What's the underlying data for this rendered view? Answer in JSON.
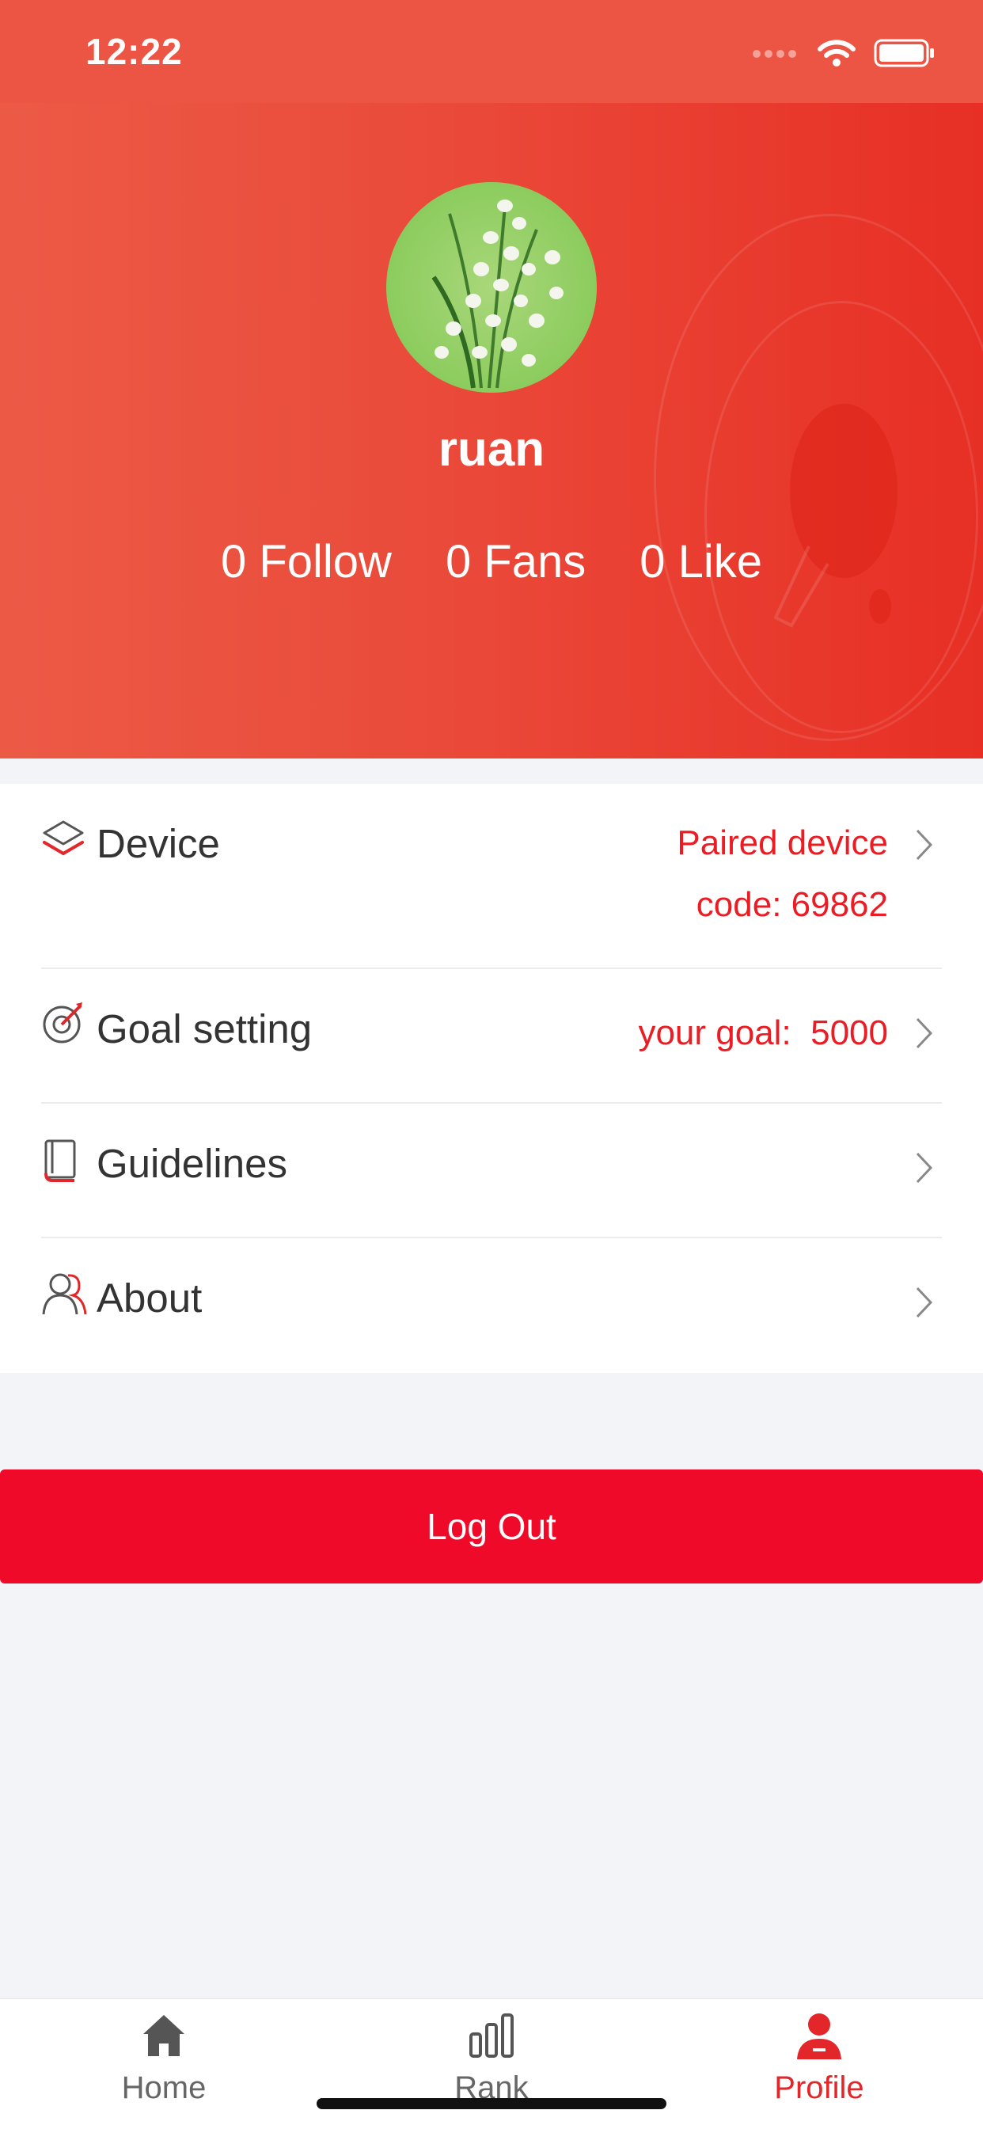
{
  "status_bar": {
    "time": "12:22"
  },
  "profile": {
    "username": "ruan",
    "stats": [
      "0 Follow",
      "0 Fans",
      "0 Like"
    ]
  },
  "menu": {
    "device": {
      "label": "Device",
      "value_line1": "Paired device",
      "value_line2": "code: 69862",
      "icon": "layers-icon"
    },
    "goal": {
      "label": "Goal setting",
      "value": "your goal:  5000",
      "icon": "target-icon"
    },
    "guidelines": {
      "label": "Guidelines",
      "icon": "book-icon"
    },
    "about": {
      "label": "About",
      "icon": "users-icon"
    }
  },
  "logout_label": "Log Out",
  "tabs": [
    {
      "label": "Home",
      "icon": "home-icon"
    },
    {
      "label": "Rank",
      "icon": "bar-chart-icon"
    },
    {
      "label": "Profile",
      "icon": "user-icon"
    }
  ],
  "colors": {
    "accent": "#ea1c24",
    "header": "#e94a3a",
    "logout": "#ee0a28"
  }
}
